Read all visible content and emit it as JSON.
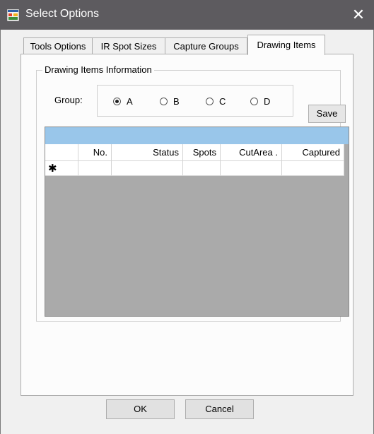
{
  "window": {
    "title": "Select Options",
    "close_glyph": "✕",
    "icon": "app-window-icon"
  },
  "tabs": [
    {
      "label": "Tools Options",
      "active": false
    },
    {
      "label": "IR Spot Sizes",
      "active": false
    },
    {
      "label": "Capture Groups",
      "active": false
    },
    {
      "label": "Drawing Items",
      "active": true
    }
  ],
  "drawing_items": {
    "groupbox_label": "Drawing Items Information",
    "group_label": "Group:",
    "radio_options": [
      {
        "label": "A",
        "selected": true
      },
      {
        "label": "B",
        "selected": false
      },
      {
        "label": "C",
        "selected": false
      },
      {
        "label": "D",
        "selected": false
      }
    ],
    "save_label": "Save",
    "grid": {
      "columns": [
        "",
        "No.",
        "Status",
        "Spots",
        "CutArea .",
        "Captured"
      ],
      "new_row_marker": "✱",
      "caption_color": "#99c6ea"
    }
  },
  "footer": {
    "ok_label": "OK",
    "cancel_label": "Cancel"
  }
}
